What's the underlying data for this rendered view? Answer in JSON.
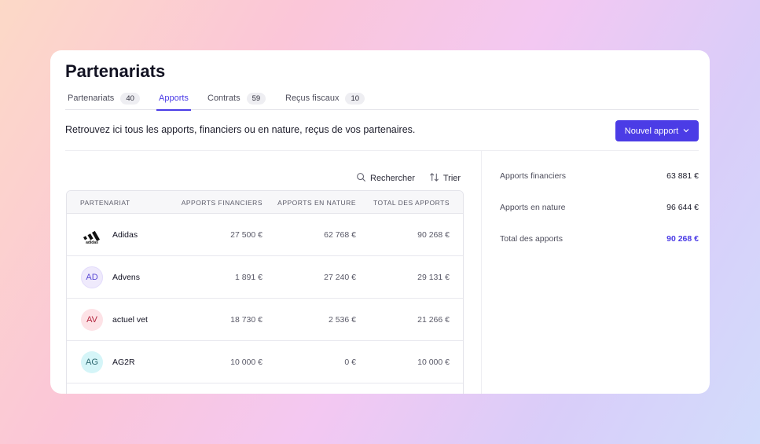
{
  "page": {
    "title": "Partenariats"
  },
  "tabs": [
    {
      "label": "Partenariats",
      "count": "40"
    },
    {
      "label": "Apports",
      "count": ""
    },
    {
      "label": "Contrats",
      "count": "59"
    },
    {
      "label": "Reçus fiscaux",
      "count": "10"
    }
  ],
  "intro": "Retrouvez ici tous les apports, financiers ou en nature, reçus de vos partenaires.",
  "new_button": {
    "label": "Nouvel apport",
    "icon": "chevron-down-icon"
  },
  "toolbar": {
    "search_label": "Rechercher",
    "sort_label": "Trier"
  },
  "table": {
    "headers": [
      "Partenariat",
      "Apports financiers",
      "Apports en nature",
      "Total des apports"
    ],
    "rows": [
      {
        "name": "Adidas",
        "initials": "",
        "financial": "27 500 €",
        "nature": "62 768 €",
        "total": "90 268 €"
      },
      {
        "name": "Advens",
        "initials": "AD",
        "financial": "1 891 €",
        "nature": "27 240 €",
        "total": "29 131 €"
      },
      {
        "name": "actuel vet",
        "initials": "AV",
        "financial": "18 730 €",
        "nature": "2 536 €",
        "total": "21 266 €"
      },
      {
        "name": "AG2R",
        "initials": "AG",
        "financial": "10 000 €",
        "nature": "0 €",
        "total": "10 000 €"
      }
    ]
  },
  "summary": {
    "financial_label": "Apports financiers",
    "financial_value": "63 881 €",
    "nature_label": "Apports en nature",
    "nature_value": "96 644 €",
    "total_label": "Total des apports",
    "total_value": "90 268 €"
  },
  "colors": {
    "accent": "#4b3ce6"
  }
}
